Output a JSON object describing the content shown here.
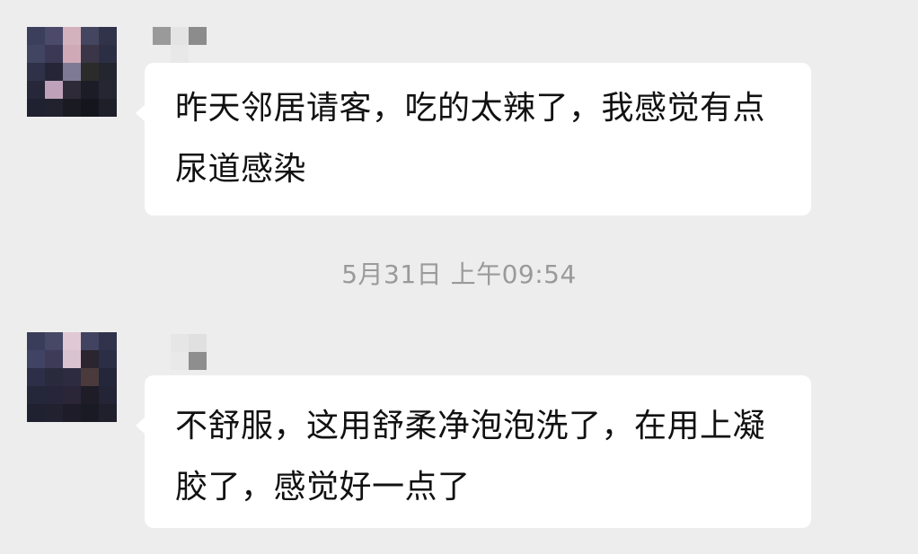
{
  "messages": [
    {
      "sender_avatar": "avatar-blurred",
      "sender_name": "",
      "text": "昨天邻居请客，吃的太辣了，我感觉有点尿道感染"
    },
    {
      "sender_avatar": "avatar-blurred",
      "sender_name": "",
      "text": "不舒服，这用舒柔净泡泡洗了，在用上凝胶了，感觉好一点了"
    }
  ],
  "timestamp": "5月31日 上午09:54",
  "colors": {
    "background": "#ededed",
    "bubble": "#ffffff",
    "text": "#111111",
    "timestamp": "#9a9a9a"
  }
}
